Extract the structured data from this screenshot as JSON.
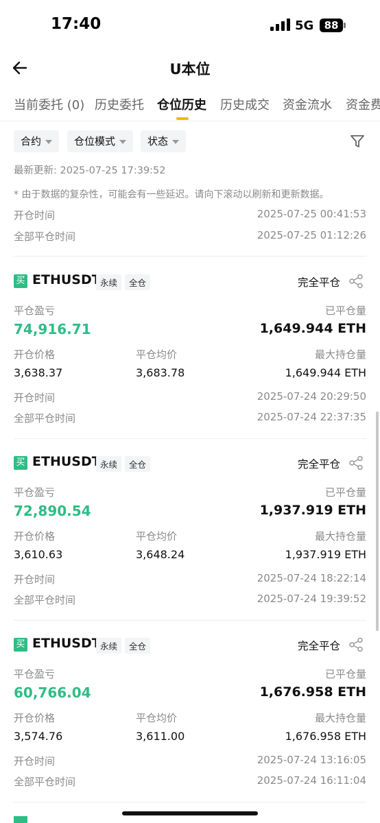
{
  "status_bar": {
    "time": "17:40",
    "network": "5G",
    "battery": "88"
  },
  "header": {
    "title": "U本位"
  },
  "tabs": [
    {
      "label": "当前委托 (0)"
    },
    {
      "label": "历史委托"
    },
    {
      "label": "仓位历史",
      "active": true
    },
    {
      "label": "历史成交"
    },
    {
      "label": "资金流水"
    },
    {
      "label": "资金费"
    }
  ],
  "filters": {
    "contract": "合约",
    "mode": "仓位模式",
    "state": "状态"
  },
  "last_update": "最新更新: 2025-07-25 17:39:52",
  "notice": "* 由于数据的复杂性，可能会有一些延迟。请向下滚动以刷新和更新数据。",
  "top_card": {
    "open_time_label": "开仓时间",
    "open_time": "2025-07-25 00:41:53",
    "close_time_label": "全部平仓时间",
    "close_time": "2025-07-25 01:12:26"
  },
  "labels": {
    "buy": "买",
    "perpetual": "永续",
    "cross": "全仓",
    "pnl": "平仓盈亏",
    "closed_qty": "已平仓量",
    "open_price": "开仓价格",
    "close_avg": "平仓均价",
    "max_hold": "最大持仓量",
    "open_time": "开仓时间",
    "close_time": "全部平仓时间"
  },
  "colors": {
    "profit": "#2ebd85",
    "accent": "#f0b90b"
  },
  "positions": [
    {
      "symbol": "ETHUSDT",
      "status": "完全平仓",
      "pnl": "74,916.71",
      "closed_qty": "1,649.944 ETH",
      "open_price": "3,638.37",
      "close_avg": "3,683.78",
      "max_hold": "1,649.944 ETH",
      "open_time": "2025-07-24 20:29:50",
      "close_time": "2025-07-24 22:37:35"
    },
    {
      "symbol": "ETHUSDT",
      "status": "完全平仓",
      "pnl": "72,890.54",
      "closed_qty": "1,937.919 ETH",
      "open_price": "3,610.63",
      "close_avg": "3,648.24",
      "max_hold": "1,937.919 ETH",
      "open_time": "2025-07-24 18:22:14",
      "close_time": "2025-07-24 19:39:52"
    },
    {
      "symbol": "ETHUSDT",
      "status": "完全平仓",
      "pnl": "60,766.04",
      "closed_qty": "1,676.958 ETH",
      "open_price": "3,574.76",
      "close_avg": "3,611.00",
      "max_hold": "1,676.958 ETH",
      "open_time": "2025-07-24 13:16:05",
      "close_time": "2025-07-24 16:11:04"
    }
  ]
}
